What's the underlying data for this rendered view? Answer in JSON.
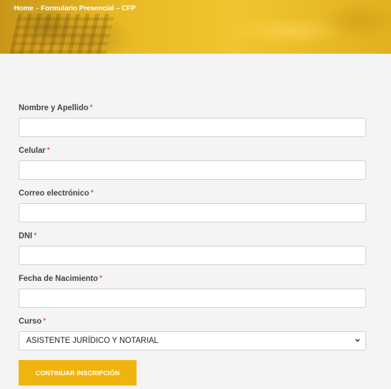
{
  "breadcrumb": {
    "home": "Home",
    "separator": "-",
    "page": "Formulario Presencial – CFP"
  },
  "form": {
    "required_marker": "*",
    "fields": [
      {
        "label": "Nombre y Apellido",
        "value": ""
      },
      {
        "label": "Celular",
        "value": ""
      },
      {
        "label": "Correo electrónico",
        "value": ""
      },
      {
        "label": "DNI",
        "value": ""
      },
      {
        "label": "Fecha de Nacimiento",
        "value": ""
      }
    ],
    "course": {
      "label": "Curso",
      "selected": "ASISTENTE JURÍDICO Y NOTARIAL"
    },
    "submit_label": "CONTINUAR INSCRIPCIÓN"
  },
  "colors": {
    "accent": "#f0b40e",
    "required": "#e03030",
    "background": "#f4f4f4"
  }
}
